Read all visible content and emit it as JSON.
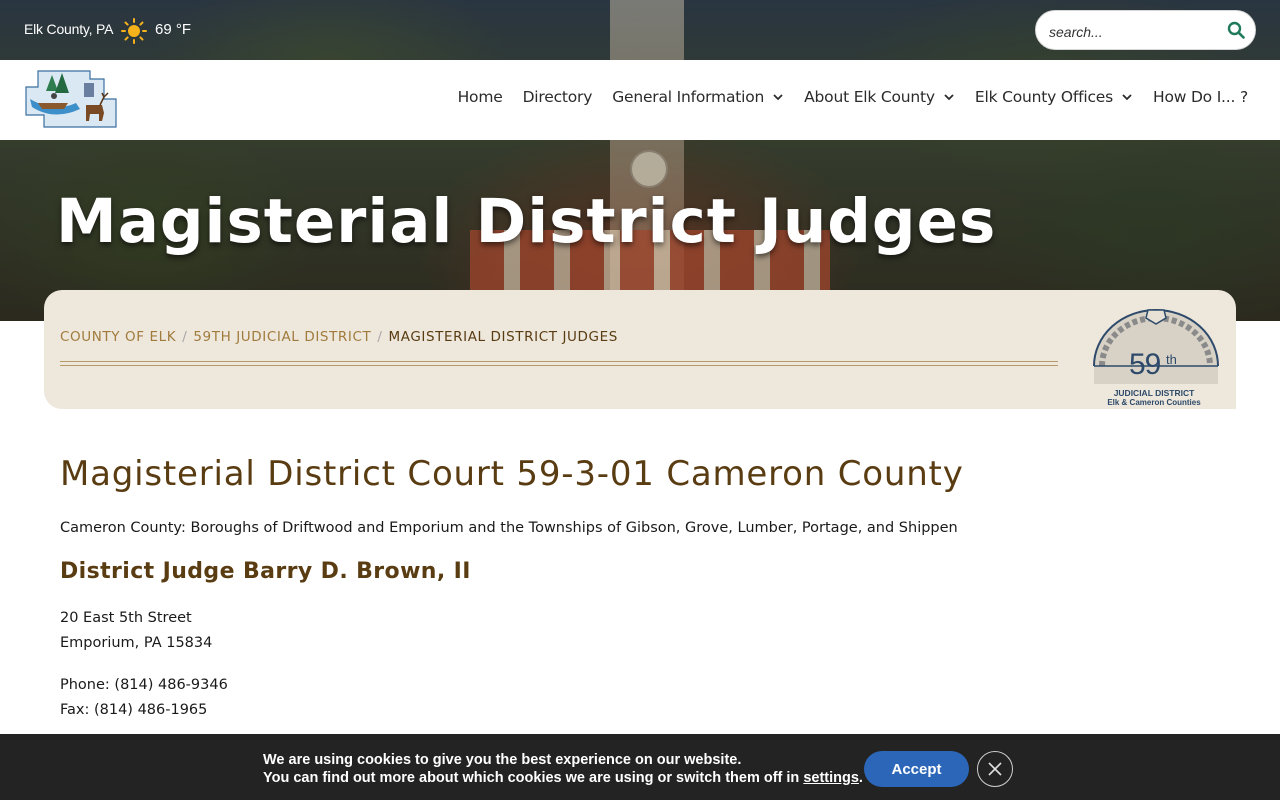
{
  "topbar": {
    "location": "Elk County, PA",
    "weather_icon": "sun-icon",
    "temperature": "69 °F",
    "search": {
      "placeholder": "search...",
      "icon": "search-icon"
    }
  },
  "nav": {
    "logo_alt": "Elk County logo",
    "items": [
      {
        "label": "Home",
        "has_dropdown": false
      },
      {
        "label": "Directory",
        "has_dropdown": false
      },
      {
        "label": "General Information",
        "has_dropdown": true
      },
      {
        "label": "About Elk County",
        "has_dropdown": true
      },
      {
        "label": "Elk County Offices",
        "has_dropdown": true
      },
      {
        "label": "How Do I... ?",
        "has_dropdown": false
      }
    ]
  },
  "hero": {
    "title": "Magisterial District Judges"
  },
  "breadcrumb": {
    "items": [
      "COUNTY OF ELK",
      "59TH JUDICIAL DISTRICT"
    ],
    "current": "MAGISTERIAL DISTRICT JUDGES",
    "separator": "/"
  },
  "seal": {
    "number": "59",
    "suffix": "th",
    "line1": "JUDICIAL DISTRICT",
    "line2": "Elk & Cameron Counties"
  },
  "content": {
    "court_title": "Magisterial District Court 59-3-01 Cameron County",
    "coverage": "Cameron County: Boroughs of Driftwood and Emporium and the Townships of Gibson, Grove, Lumber, Portage, and Shippen",
    "judge": "District Judge Barry D. Brown, II",
    "address_line1": "20 East 5th Street",
    "address_line2": "Emporium, PA 15834",
    "phone": "Phone: (814) 486-9346",
    "fax": "Fax: (814) 486-1965"
  },
  "cookie": {
    "line1": "We are using cookies to give you the best experience on our website.",
    "line2_prefix": "You can find out more about which cookies we are using or switch them off in ",
    "line2_link": "settings",
    "line2_suffix": ".",
    "accept_label": "Accept",
    "close_icon": "close-icon"
  },
  "colors": {
    "heading_brown": "#5a3c12",
    "breadcrumb_link": "#a17b3c",
    "crumb_card_bg": "#ede7dc",
    "accept_blue": "#2c66b8",
    "cookie_bg": "#232323",
    "search_icon_green": "#1f7a5a"
  }
}
